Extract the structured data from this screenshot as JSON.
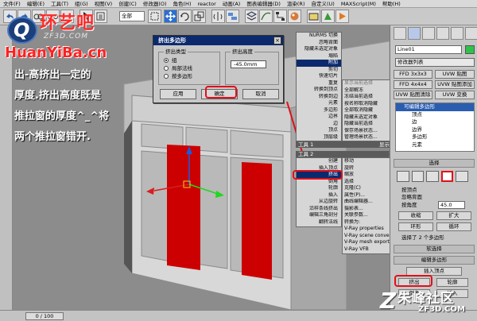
{
  "menubar": [
    "文件(F)",
    "编辑(E)",
    "工具(T)",
    "组(G)",
    "视图(V)",
    "创建(C)",
    "修改器(O)",
    "角色(H)",
    "reactor",
    "动画(A)",
    "图表编辑器(D)",
    "渲染(R)",
    "自定义(U)",
    "MAXScript(M)",
    "帮助(H)"
  ],
  "toolbar": {
    "selection_mode": "全部"
  },
  "watermark": {
    "site_cn": "环艺吧",
    "site_sub": "ZF3D.COM",
    "url": "HuanYiBa.cn",
    "q_mark": "Q",
    "tip_lines": [
      "出-高挤出一定的",
      "厚度.挤出高度既是",
      "推拉窗的厚度^_^将",
      "两个推拉窗错开."
    ]
  },
  "dialog": {
    "title": "挤出多边形",
    "close": "×",
    "type_group": "挤出类型",
    "options": [
      "组",
      "局部法线",
      "按多边形"
    ],
    "selected_option": 0,
    "height_group": "挤出高度",
    "height_value": "-45.0mm",
    "apply": "应用",
    "ok": "确定",
    "cancel": "取消"
  },
  "quad_top_left": {
    "items": [
      "NURMS 切换",
      "忽略背面",
      "隐藏未选定对象",
      "塌陷",
      "附加",
      "剪切",
      "快速切片",
      "重复",
      "转换到顶点",
      "转换到边",
      "元素",
      "多边形",
      "边界",
      "边",
      "顶点",
      "顶层级"
    ],
    "highlighted": 4,
    "bar_tools1": "工具 1"
  },
  "quad_top_right": {
    "header": "显示当前选择",
    "items": [
      "全部解冻",
      "冻结当前选择",
      "按名称取消隐藏",
      "全部取消隐藏",
      "隐藏未选定对象",
      "隐藏当前选择",
      "保存场景状态...",
      "管理场景状态..."
    ],
    "bar_display": "显示"
  },
  "quad_bottom_left": {
    "bar_tools2": "工具 2",
    "items": [
      "创建",
      "插入顶点",
      "挤出",
      "倒角",
      "轮廓",
      "插入",
      "从边旋转",
      "沿样条线挤出",
      "编辑三角剖分",
      "翻转法线"
    ],
    "highlighted": 2
  },
  "quad_bottom_right": {
    "bar_transform": "变换",
    "items": [
      "移动",
      "旋转",
      "缩放",
      "选择",
      "克隆(C)",
      "属性(P)...",
      "曲线编辑器...",
      "摄影表...",
      "关联参数...",
      "转换为:",
      "V-Ray properties",
      "V-Ray scene converter",
      "V-Ray mesh export",
      "V-Ray VFB"
    ]
  },
  "command_panel": {
    "object_name": "Line01",
    "modifier_list": "修改器列表",
    "btn_ffd": "FFD 3x3x3",
    "btn_mapping": "UVW 贴图",
    "btn_ffd2": "FFD 4x4x4",
    "btn_uvw": "UVW 贴图添加",
    "btn_uvw_clear": "UVW 贴图清除",
    "btn_uvw_xform": "UVW 变换",
    "stack": [
      "可编辑多边形",
      "顶点",
      "边",
      "边界",
      "多边形",
      "元素"
    ],
    "rollout_select": "选择",
    "by_vertex": "按顶点",
    "ignore_backface": "忽略背面",
    "by_angle": "按角度",
    "angle_value": "45.0",
    "shrink": "收缩",
    "grow": "扩大",
    "ring": "环形",
    "loop": "循环",
    "selected_count": "选择了 2 个多边形",
    "soft_select": "软选择",
    "edit_poly": "编辑多边形",
    "insert_vertex": "插入顶点",
    "extrude": "挤出",
    "outline": "轮廓",
    "bevel": "倒角",
    "inset": "插入"
  },
  "status": {
    "frame": "0 / 100"
  },
  "corner_logo": {
    "mark": "Z",
    "cn": "朱峰社区",
    "sub": "ZF3D.COM"
  }
}
